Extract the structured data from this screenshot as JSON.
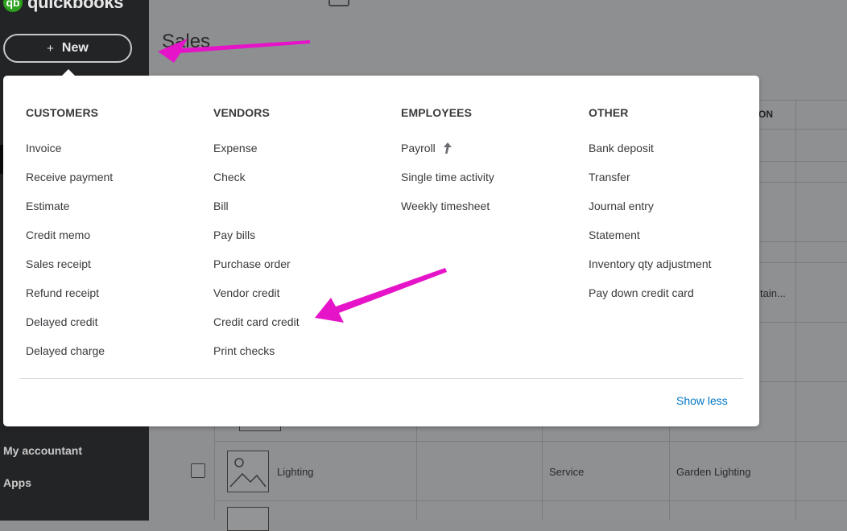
{
  "sidebar": {
    "brand": "quickbooks",
    "brand_glyph": "qb",
    "new_button": {
      "plus": "+",
      "label": "New"
    },
    "nav_items": [
      "My accountant",
      "Apps"
    ]
  },
  "main": {
    "page_title": "Sales",
    "table": {
      "header_fragment": "ON",
      "truncated_cell": "tain...",
      "visible_row": {
        "name": "Lighting",
        "type": "Service",
        "category": "Garden Lighting"
      }
    }
  },
  "new_menu": {
    "columns": [
      {
        "header": "CUSTOMERS",
        "items": [
          {
            "label": "Invoice"
          },
          {
            "label": "Receive payment"
          },
          {
            "label": "Estimate"
          },
          {
            "label": "Credit memo"
          },
          {
            "label": "Sales receipt"
          },
          {
            "label": "Refund receipt"
          },
          {
            "label": "Delayed credit"
          },
          {
            "label": "Delayed charge"
          }
        ]
      },
      {
        "header": "VENDORS",
        "items": [
          {
            "label": "Expense"
          },
          {
            "label": "Check"
          },
          {
            "label": "Bill"
          },
          {
            "label": "Pay bills"
          },
          {
            "label": "Purchase order"
          },
          {
            "label": "Vendor credit"
          },
          {
            "label": "Credit card credit"
          },
          {
            "label": "Print checks"
          }
        ]
      },
      {
        "header": "EMPLOYEES",
        "items": [
          {
            "label": "Payroll",
            "icon": "upgrade-arrow-icon"
          },
          {
            "label": "Single time activity"
          },
          {
            "label": "Weekly timesheet"
          }
        ]
      },
      {
        "header": "OTHER",
        "items": [
          {
            "label": "Bank deposit"
          },
          {
            "label": "Transfer"
          },
          {
            "label": "Journal entry"
          },
          {
            "label": "Statement"
          },
          {
            "label": "Inventory qty adjustment"
          },
          {
            "label": "Pay down credit card"
          }
        ]
      }
    ],
    "show_less": "Show less"
  },
  "annotations": {
    "arrow_color": "#e614c8"
  },
  "colors": {
    "sidebar": "#232426",
    "brand_green": "#2ca01c",
    "link_blue": "#0077c5",
    "menu_text": "#393a3d"
  }
}
